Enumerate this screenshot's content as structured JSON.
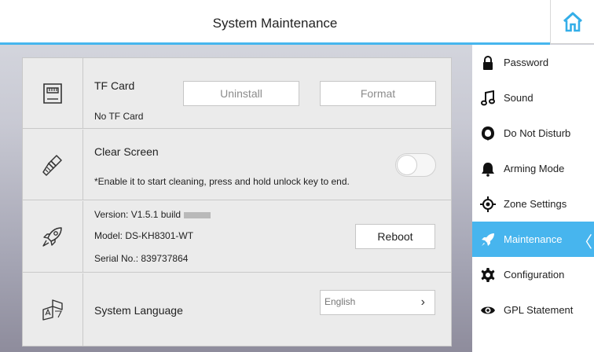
{
  "header": {
    "title": "System Maintenance"
  },
  "colors": {
    "accent": "#46b6ee",
    "active_item": "#47b5ee"
  },
  "icons": {
    "home": "home-icon",
    "tf_card": "sd-card-icon",
    "clear_screen": "brush-icon",
    "version": "rocket-icon",
    "language": "translate-icon"
  },
  "tf_card": {
    "label": "TF Card",
    "status": "No TF Card",
    "uninstall_label": "Uninstall",
    "format_label": "Format"
  },
  "clear_screen": {
    "label": "Clear Screen",
    "hint": "*Enable it to start cleaning, press and hold unlock key to end.",
    "enabled": false
  },
  "device": {
    "version": "Version: V1.5.1 build",
    "model": "Model: DS-KH8301-WT",
    "serial": "Serial No.: 839737864",
    "reboot_label": "Reboot"
  },
  "language": {
    "label": "System Language",
    "selected": "English",
    "chevron": "›"
  },
  "sidebar": {
    "items": [
      {
        "label": "Password",
        "icon": "lock-icon"
      },
      {
        "label": "Sound",
        "icon": "music-note-icon"
      },
      {
        "label": "Do Not Disturb",
        "icon": "moon-icon"
      },
      {
        "label": "Arming Mode",
        "icon": "bell-icon"
      },
      {
        "label": "Zone Settings",
        "icon": "target-icon"
      },
      {
        "label": "Maintenance",
        "icon": "rocket-icon",
        "active": true,
        "chevron": "〈"
      },
      {
        "label": "Configuration",
        "icon": "gear-icon"
      },
      {
        "label": "GPL Statement",
        "icon": "eye-icon"
      }
    ]
  }
}
